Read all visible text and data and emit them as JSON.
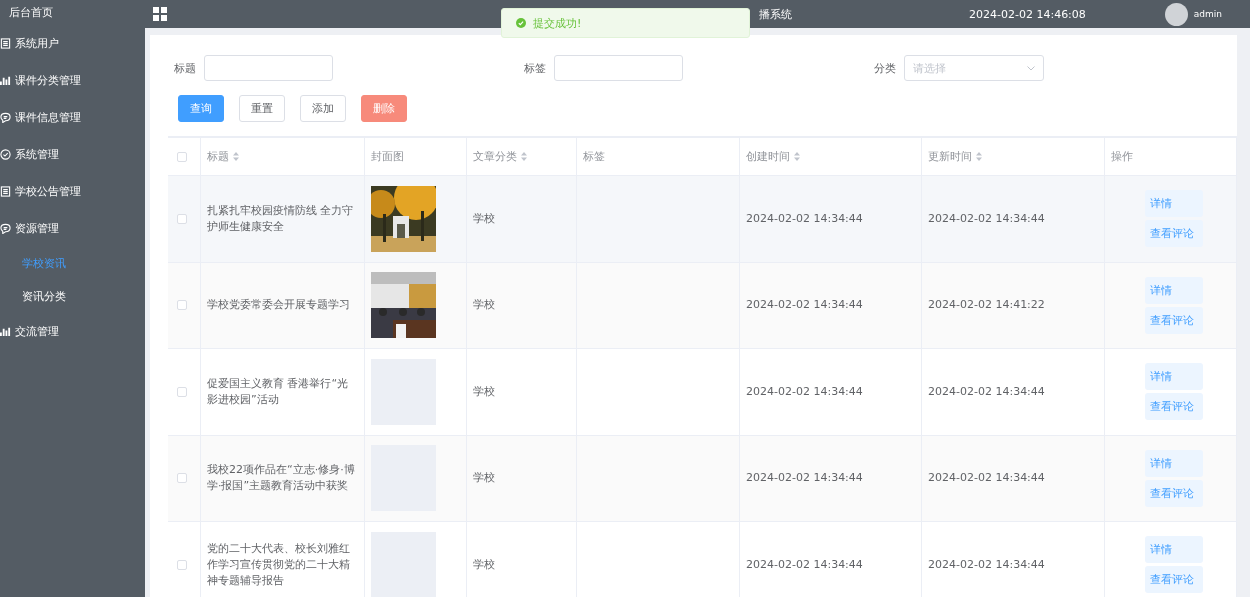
{
  "sidebar": {
    "items": [
      {
        "label": "后台首页"
      },
      {
        "label": "系统用户"
      },
      {
        "label": "课件分类管理"
      },
      {
        "label": "课件信息管理"
      },
      {
        "label": "系统管理"
      },
      {
        "label": "学校公告管理"
      },
      {
        "label": "资源管理",
        "children": [
          {
            "label": "学校资讯",
            "selected": true
          },
          {
            "label": "资讯分类",
            "selected": false
          }
        ]
      },
      {
        "label": "交流管理"
      }
    ]
  },
  "header": {
    "title": "播系统",
    "datetime": "2024-02-02 14:46:08",
    "user": "admin"
  },
  "toast": {
    "message": "提交成功!"
  },
  "filters": [
    {
      "label": "标题",
      "kind": "input"
    },
    {
      "label": "标签",
      "kind": "input"
    },
    {
      "label": "分类",
      "kind": "select",
      "placeholder": "请选择"
    }
  ],
  "buttons": [
    {
      "label": "查询",
      "kind": "primary"
    },
    {
      "label": "重置",
      "kind": "plain"
    },
    {
      "label": "添加",
      "kind": "plain"
    },
    {
      "label": "删除",
      "kind": "danger"
    }
  ],
  "table": {
    "all_checked": false,
    "columns": [
      {
        "label": "标题",
        "sortable": true
      },
      {
        "label": "封面图",
        "sortable": false
      },
      {
        "label": "文章分类",
        "sortable": true
      },
      {
        "label": "标签",
        "sortable": false
      },
      {
        "label": "创建时间",
        "sortable": true
      },
      {
        "label": "更新时间",
        "sortable": true
      },
      {
        "label": "操作",
        "sortable": false
      }
    ],
    "rows": [
      {
        "checked": false,
        "title": "扎紧扎牢校园疫情防线 全力守护师生健康安全",
        "cover": {
          "kind": "picture"
        },
        "category": "学校",
        "created": "2024-02-02 14:34:44",
        "updated": "2024-02-02 14:34:44",
        "actions": [
          "详情",
          "查看评论"
        ]
      },
      {
        "checked": false,
        "title": "学校党委常委会开展专题学习",
        "cover": {
          "kind": "picture"
        },
        "category": "学校",
        "created": "2024-02-02 14:34:44",
        "updated": "2024-02-02 14:41:22",
        "actions": [
          "详情",
          "查看评论"
        ]
      },
      {
        "checked": false,
        "title": "促爱国主义教育 香港举行“光影进校园”活动",
        "category": "学校",
        "created": "2024-02-02 14:34:44",
        "updated": "2024-02-02 14:34:44",
        "actions": [
          "详情",
          "查看评论"
        ]
      },
      {
        "checked": false,
        "title": "我校22项作品在“立志·修身·博学·报国”主题教育活动中获奖",
        "category": "学校",
        "created": "2024-02-02 14:34:44",
        "updated": "2024-02-02 14:34:44",
        "actions": [
          "详情",
          "查看评论"
        ]
      },
      {
        "checked": false,
        "title": "党的二十大代表、校长刘雅红作学习宣传贯彻党的二十大精神专题辅导报告",
        "category": "学校",
        "created": "2024-02-02 14:34:44",
        "updated": "2024-02-02 14:34:44",
        "actions": [
          "详情",
          "查看评论"
        ]
      }
    ]
  }
}
